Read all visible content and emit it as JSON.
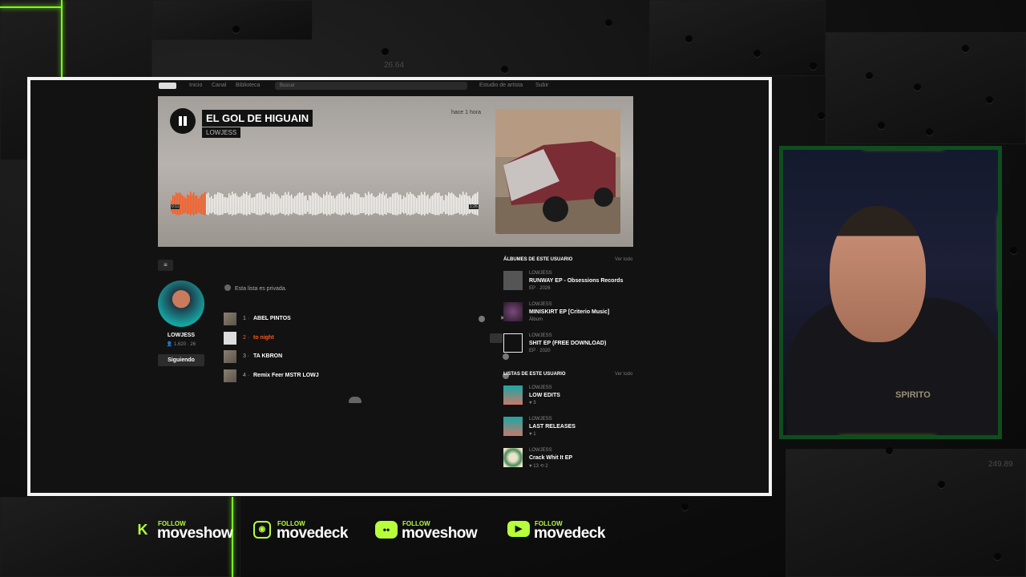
{
  "background": {
    "numbers": [
      "26.64",
      "249.89"
    ]
  },
  "browser": {
    "navbar": {
      "items": [
        "Inicio",
        "Canal",
        "Biblioteca"
      ],
      "search_placeholder": "Buscar",
      "right_items": [
        "Estudio de artista",
        "Subir"
      ]
    },
    "hero": {
      "title": "EL GOL DE HIGUAIN",
      "artist": "LOWJESS",
      "posted": "hace 1 hora",
      "time_elapsed": "0:11",
      "time_total": "1:26",
      "progress": 0.11
    },
    "profile": {
      "name": "LOWJESS",
      "followers": "1.620",
      "following": "26",
      "follow_button": "Siguiendo"
    },
    "playlist": {
      "private_notice": "Esta lista es privada.",
      "tracks": [
        {
          "num": "1 ·",
          "name": "ABEL PINTOS",
          "plays": "3"
        },
        {
          "num": "2 ·",
          "name": "to night",
          "plays": ""
        },
        {
          "num": "3 ·",
          "name": "TA KBRON",
          "plays": ""
        },
        {
          "num": "4 ·",
          "name": "Remix Feer MSTR LOWJ",
          "plays": ""
        }
      ]
    },
    "albums_section": {
      "heading": "ÁLBUMES DE ESTE USUARIO",
      "view_all": "Ver todo",
      "items": [
        {
          "artist": "LOWJESS",
          "title": "RUNWAY EP - Obsessions Records",
          "sub": "EP · 2026"
        },
        {
          "artist": "LOWJESS",
          "title": "MINISKIRT EP [Criterio Music]",
          "sub": "Álbum"
        },
        {
          "artist": "LOWJESS",
          "title": "SHIT EP (FREE DOWNLOAD)",
          "sub": "EP · 2020"
        }
      ]
    },
    "lists_section": {
      "heading": "LISTAS DE ESTE USUARIO",
      "view_all": "Ver todo",
      "items": [
        {
          "artist": "LOWJESS",
          "title": "LOW EDITS",
          "sub": "♥ 3"
        },
        {
          "artist": "LOWJESS",
          "title": "LAST RELEASES",
          "sub": "♥ 1"
        },
        {
          "artist": "LOWJESS",
          "title": "Crack Whit It EP",
          "sub": "♥ 13  ⟲ 2"
        }
      ]
    }
  },
  "webcam": {
    "shirt_text": "SPIRITO"
  },
  "socials": [
    {
      "follow": "FOLLOW",
      "name": "moveshow",
      "icon": "kick-icon"
    },
    {
      "follow": "FOLLOW",
      "name": "movedeck",
      "icon": "instagram-icon"
    },
    {
      "follow": "FOLLOW",
      "name": "moveshow",
      "icon": "discord-icon"
    },
    {
      "follow": "FOLLOW",
      "name": "movedeck",
      "icon": "youtube-icon"
    }
  ],
  "colors": {
    "accent": "#ff5a1f",
    "neon": "#7cff1a",
    "social_green": "#b6ff3a"
  }
}
